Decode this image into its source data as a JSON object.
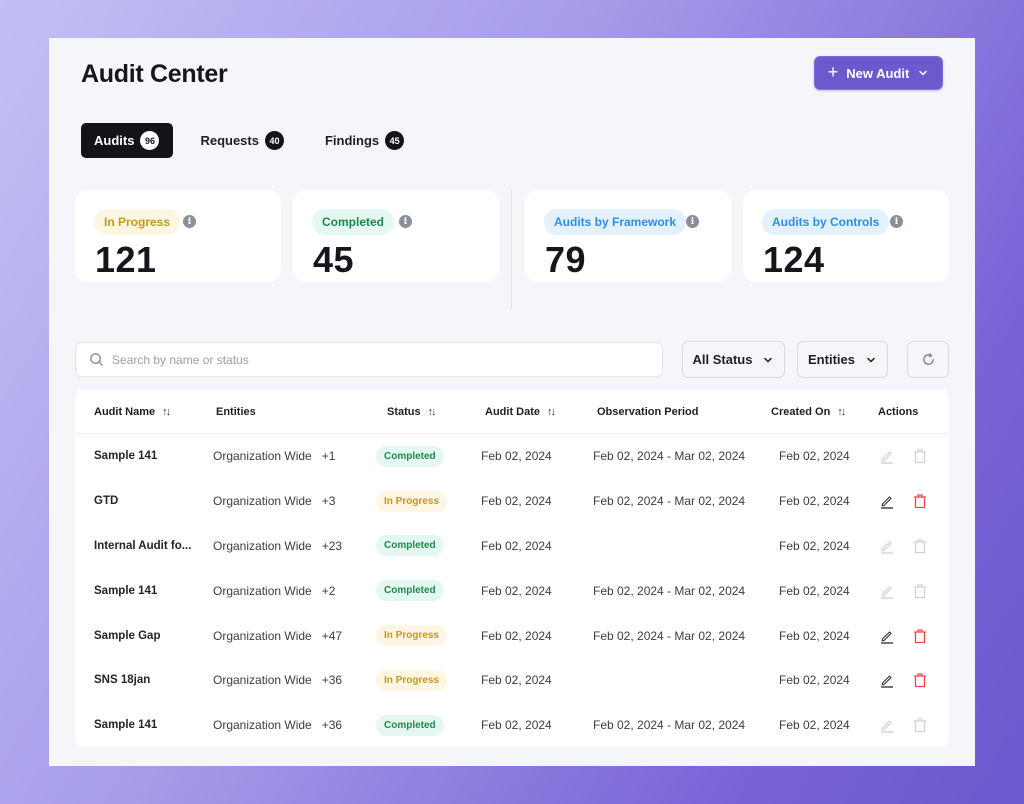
{
  "header": {
    "title": "Audit Center",
    "new_button_label": "New Audit"
  },
  "tabs": [
    {
      "label": "Audits",
      "count": "96",
      "active": true
    },
    {
      "label": "Requests",
      "count": "40",
      "active": false
    },
    {
      "label": "Findings",
      "count": "45",
      "active": false
    }
  ],
  "stats": [
    {
      "label": "In Progress",
      "value": "121",
      "color": "#c49a1a"
    },
    {
      "label": "Completed",
      "value": "45",
      "color": "#1f8a50"
    },
    {
      "label": "Audits by Framework",
      "value": "79",
      "color": "#2d8fe6"
    },
    {
      "label": "Audits by Controls",
      "value": "124",
      "color": "#2d8fe6"
    }
  ],
  "toolbar": {
    "search_placeholder": "Search by name or status",
    "search_value": "",
    "status_filter": "All Status",
    "entities_filter": "Entities"
  },
  "table": {
    "columns": [
      "Audit Name",
      "Entities",
      "Status",
      "Audit Date",
      "Observation Period",
      "Created On",
      "Actions"
    ],
    "rows": [
      {
        "name": "Sample 141",
        "entity": "Organization Wide",
        "extra": "+1",
        "status": "Completed",
        "audit_date": "Feb 02, 2024",
        "observation": "Feb 02, 2024 - Mar 02, 2024",
        "created": "Feb 02, 2024",
        "actions_enabled": false
      },
      {
        "name": "GTD",
        "entity": "Organization Wide",
        "extra": "+3",
        "status": "In Progress",
        "audit_date": "Feb 02, 2024",
        "observation": "Feb 02, 2024 - Mar 02, 2024",
        "created": "Feb 02, 2024",
        "actions_enabled": true
      },
      {
        "name": "Internal Audit fo...",
        "entity": "Organization Wide",
        "extra": "+23",
        "status": "Completed",
        "audit_date": "Feb 02, 2024",
        "observation": "",
        "created": "Feb 02, 2024",
        "actions_enabled": false
      },
      {
        "name": "Sample 141",
        "entity": "Organization Wide",
        "extra": "+2",
        "status": "Completed",
        "audit_date": "Feb 02, 2024",
        "observation": "Feb 02, 2024 - Mar 02, 2024",
        "created": "Feb 02, 2024",
        "actions_enabled": false
      },
      {
        "name": "Sample Gap",
        "entity": "Organization Wide",
        "extra": "+47",
        "status": "In Progress",
        "audit_date": "Feb 02, 2024",
        "observation": "Feb 02, 2024 - Mar 02, 2024",
        "created": "Feb 02, 2024",
        "actions_enabled": true
      },
      {
        "name": "SNS 18jan",
        "entity": "Organization Wide",
        "extra": "+36",
        "status": "In Progress",
        "audit_date": "Feb 02, 2024",
        "observation": "",
        "created": "Feb 02, 2024",
        "actions_enabled": true
      },
      {
        "name": "Sample 141",
        "entity": "Organization Wide",
        "extra": "+36",
        "status": "Completed",
        "audit_date": "Feb 02, 2024",
        "observation": "Feb 02, 2024 - Mar 02, 2024",
        "created": "Feb 02, 2024",
        "actions_enabled": false
      }
    ]
  },
  "colors": {
    "accent": "#6a5acd",
    "completed": "#1f8a50",
    "in_progress": "#c49a1a",
    "delete_active": "#ef4444",
    "disabled_icon": "#cdd3dd"
  }
}
